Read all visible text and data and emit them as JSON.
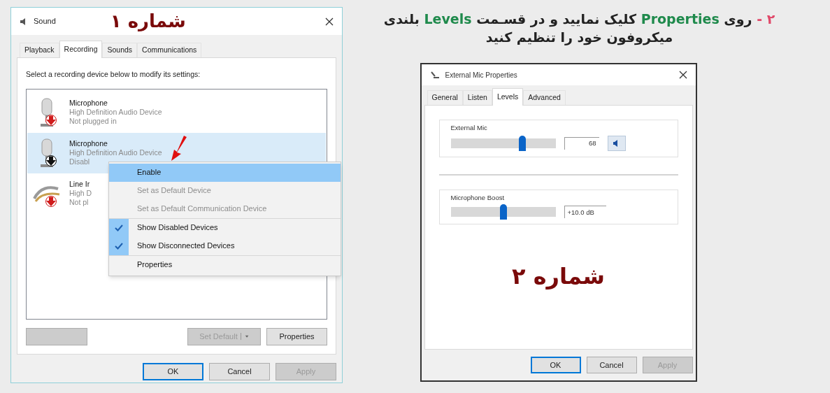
{
  "sound_dialog": {
    "title": "Sound",
    "annotation": "شماره ۱",
    "tabs": [
      {
        "label": "Playback",
        "selected": false
      },
      {
        "label": "Recording",
        "selected": true
      },
      {
        "label": "Sounds",
        "selected": false
      },
      {
        "label": "Communications",
        "selected": false
      }
    ],
    "instruction": "Select a recording device below to modify its settings:",
    "devices": [
      {
        "kind": "microphone",
        "name": "Microphone",
        "driver": "High Definition Audio Device",
        "status": "Not plugged in",
        "color": "#d01c1c",
        "selected": false
      },
      {
        "kind": "microphone",
        "name": "Microphone",
        "driver": "High Definition Audio Device",
        "status": "Disabl",
        "color": "#111111",
        "selected": true
      },
      {
        "kind": "line-in",
        "name": "Line Ir",
        "driver": "High D",
        "status": "Not pl",
        "color": "#d01c1c",
        "selected": false
      }
    ],
    "context_menu": [
      [
        {
          "label": "Enable",
          "selected": true,
          "disabled": false,
          "checked": false
        },
        {
          "label": "Set as Default Device",
          "selected": false,
          "disabled": true,
          "checked": false
        },
        {
          "label": "Set as Default Communication Device",
          "selected": false,
          "disabled": true,
          "checked": false
        }
      ],
      [
        {
          "label": "Show Disabled Devices",
          "selected": false,
          "disabled": false,
          "checked": true
        },
        {
          "label": "Show Disconnected Devices",
          "selected": false,
          "disabled": false,
          "checked": true
        }
      ],
      [
        {
          "label": "Properties",
          "selected": false,
          "disabled": false,
          "checked": false
        }
      ]
    ],
    "list_buttons": [
      {
        "disabled": true,
        "dropdown": false
      },
      {
        "label": "Set Default",
        "disabled": true,
        "dropdown": true
      },
      {
        "label": "Properties",
        "disabled": false,
        "dropdown": false
      }
    ],
    "buttons": [
      {
        "label": "OK",
        "disabled": false,
        "default": true
      },
      {
        "label": "Cancel",
        "disabled": false,
        "default": false
      },
      {
        "label": "Apply",
        "disabled": true,
        "default": false
      }
    ]
  },
  "instruction": {
    "lines": [
      [
        {
          "kind": "number",
          "text": "۲ -"
        },
        {
          "kind": "plain",
          "text": "روی"
        },
        {
          "kind": "keyword",
          "text": "Properties"
        },
        {
          "kind": "plain",
          "text": "کلیک نمایید و در قسـمت"
        },
        {
          "kind": "keyword",
          "text": "Levels"
        },
        {
          "kind": "plain",
          "text": "بلندی"
        }
      ],
      [
        {
          "kind": "plain",
          "text": "میکروفون خود را تنظیم کنید"
        }
      ]
    ]
  },
  "properties_dialog": {
    "title": "External Mic Properties",
    "annotation": "شماره ۲",
    "tabs": [
      {
        "label": "General",
        "selected": false
      },
      {
        "label": "Listen",
        "selected": false
      },
      {
        "label": "Levels",
        "selected": true
      },
      {
        "label": "Advanced",
        "selected": false
      }
    ],
    "groups": [
      {
        "title": "External Mic",
        "level": 0.68,
        "value": "68",
        "speaker": true
      },
      {
        "title": "Microphone Boost",
        "level": 0.5,
        "value": "+10.0 dB",
        "speaker": false
      }
    ],
    "buttons": [
      {
        "label": "OK",
        "disabled": false,
        "default": true
      },
      {
        "label": "Cancel",
        "disabled": false,
        "default": false
      },
      {
        "label": "Apply",
        "disabled": true,
        "default": false
      }
    ]
  }
}
